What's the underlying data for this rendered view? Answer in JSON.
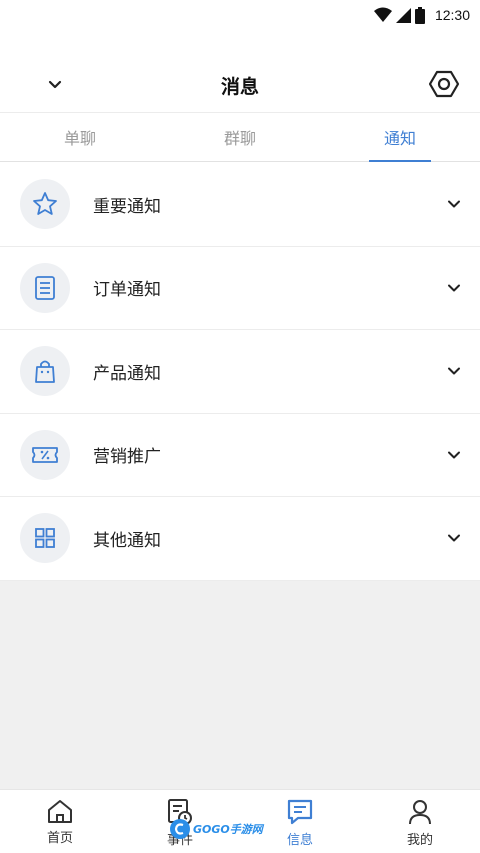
{
  "status_bar": {
    "time": "12:30"
  },
  "header": {
    "title": "消息"
  },
  "tabs": [
    {
      "label": "单聊",
      "active": false
    },
    {
      "label": "群聊",
      "active": false
    },
    {
      "label": "通知",
      "active": true
    }
  ],
  "notifications": [
    {
      "label": "重要通知",
      "icon": "star-icon"
    },
    {
      "label": "订单通知",
      "icon": "document-list-icon"
    },
    {
      "label": "产品通知",
      "icon": "shopping-bag-icon"
    },
    {
      "label": "营销推广",
      "icon": "coupon-percent-icon"
    },
    {
      "label": "其他通知",
      "icon": "grid-icon"
    }
  ],
  "bottom_nav": [
    {
      "label": "首页",
      "icon": "home-icon",
      "active": false
    },
    {
      "label": "事件",
      "icon": "event-icon",
      "active": false
    },
    {
      "label": "信息",
      "icon": "message-icon",
      "active": true
    },
    {
      "label": "我的",
      "icon": "user-icon",
      "active": false
    }
  ],
  "watermark": {
    "text": "GOGO手游网"
  },
  "colors": {
    "accent": "#3f7fd3",
    "icon_bg": "#eef0f3",
    "empty_area": "#f0f0f0"
  }
}
